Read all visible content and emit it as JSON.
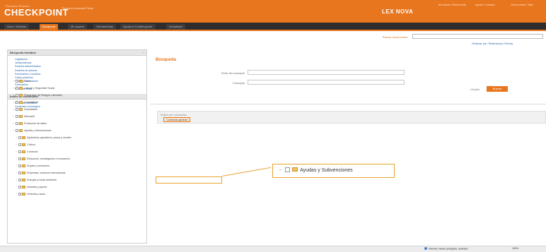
{
  "header": {
    "brand_small": "Thomson Reuters",
    "brand": "CHECKPOINT",
    "brand_sub": "Thomson Aranzadi Fiscal",
    "product": "LEX NOVA",
    "top_links": [
      "Mi cuenta / Preferencias",
      "Ayuda / Contacto",
      "Cerrar sesión / Salir"
    ]
  },
  "nav": {
    "tabs": [
      "Inicio / Noticias",
      "Búsqueda",
      "Mi carpeta",
      "Herramientas",
      "Ayuda al Contribuyente",
      "Actualidad"
    ],
    "active_index": 1
  },
  "search": {
    "label": "Buscar documentos",
    "placeholder": "",
    "sort_text": "Ordenar por: Relevancia | Fecha"
  },
  "sidebar": {
    "section1": {
      "title": "Búsqueda temática",
      "items": [
        "Legislación",
        "Jurisprudencia",
        "Doctrina administrativa",
        "Doctrina de autores",
        "Formularios y modelos",
        "Casos prácticos",
        "Tablas y calendarios",
        "Formularios",
        "Memento fiscal"
      ]
    },
    "section2": {
      "title": "Índice de contenidos",
      "items": [
        "Contenido temático",
        "Contenido cronológico"
      ]
    },
    "toggle": "−"
  },
  "main": {
    "title": "Búsqueda",
    "fields": [
      {
        "label": "Texto del concepto",
        "value": ""
      },
      {
        "label": "Concepto",
        "value": ""
      }
    ],
    "clear_label": "Limpiar",
    "search_button": "Buscar",
    "tree_header": "Índice por conceptos",
    "tree_root": "Contenido general",
    "tree_items": [
      {
        "label": "Fiscal",
        "sub": false
      },
      {
        "label": "Laboral y Seguridad Social",
        "sub": false
      },
      {
        "label": "Prevención de Riesgos Laborales",
        "sub": false
      },
      {
        "label": "Contabilidad",
        "sub": false
      },
      {
        "label": "Sociedades",
        "sub": false
      },
      {
        "label": "Mercantil",
        "sub": false
      },
      {
        "label": "Protección de datos",
        "sub": false
      },
      {
        "label": "Ayudas y Subvenciones",
        "sub": false
      },
      {
        "label": "Agricultura, ganadería, pesca y montes",
        "sub": true
      },
      {
        "label": "Cultura",
        "sub": true
      },
      {
        "label": "Comercio",
        "sub": true
      },
      {
        "label": "Educación, investigación e innovación",
        "sub": true
      },
      {
        "label": "Empleo y formación",
        "sub": true
      },
      {
        "label": "Empresas, comercio internacional",
        "sub": true
      },
      {
        "label": "Energía y medio ambiente",
        "sub": true
      },
      {
        "label": "Industria y pymes",
        "sub": true
      },
      {
        "label": "Vivienda y suelo",
        "sub": true
      }
    ],
    "callout_label": "Ayudas y Subvenciones"
  },
  "status": {
    "text": "Internet | Modo protegido: activado",
    "zoom": "100%"
  },
  "colors": {
    "brand_orange": "#e8761f",
    "nav_dark": "#2d2d2d",
    "link_blue": "#1e5fb0",
    "highlight": "#e8a32e"
  }
}
